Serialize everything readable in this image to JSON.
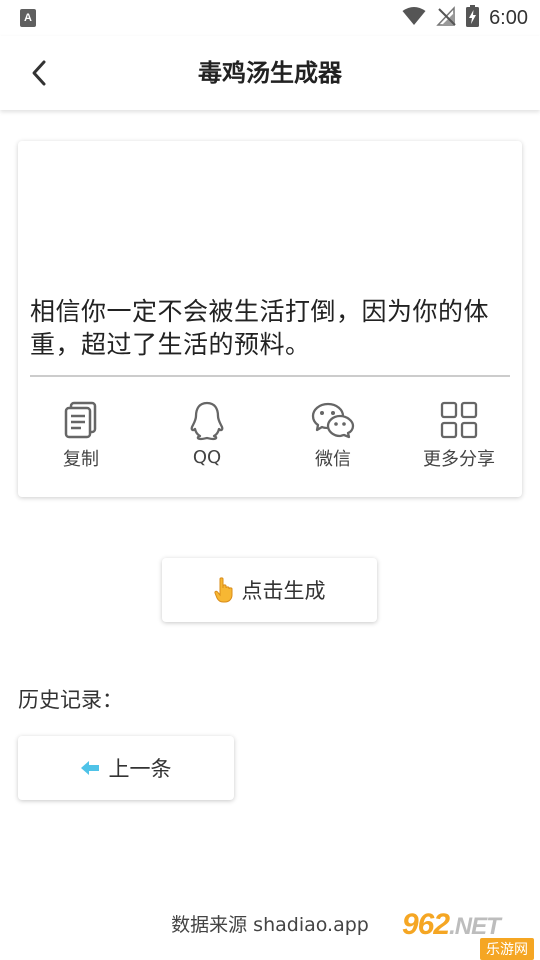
{
  "status_bar": {
    "left_badge": "A",
    "time": "6:00",
    "icons": [
      "wifi-icon",
      "no-signal-icon",
      "battery-charging-icon"
    ]
  },
  "app_bar": {
    "title": "毒鸡汤生成器",
    "back_icon": "chevron-left-icon"
  },
  "card": {
    "quote": "相信你一定不会被生活打倒，因为你的体重，超过了生活的预料。",
    "actions": [
      {
        "label": "复制",
        "icon": "copy-icon"
      },
      {
        "label": "QQ",
        "icon": "qq-icon"
      },
      {
        "label": "微信",
        "icon": "wechat-icon"
      },
      {
        "label": "更多分享",
        "icon": "grid-icon"
      }
    ]
  },
  "generate": {
    "label": "点击生成",
    "icon": "pointing-hand-icon"
  },
  "history": {
    "title": "历史记录：",
    "prev_label": "上一条",
    "prev_icon": "arrow-left-icon",
    "accent_color": "#4fc3e8"
  },
  "footer": {
    "source": "数据来源 shadiao.app"
  },
  "watermark": {
    "number": "962",
    "suffix": ".NET",
    "site": "乐游网",
    "color": "#f5a623"
  }
}
